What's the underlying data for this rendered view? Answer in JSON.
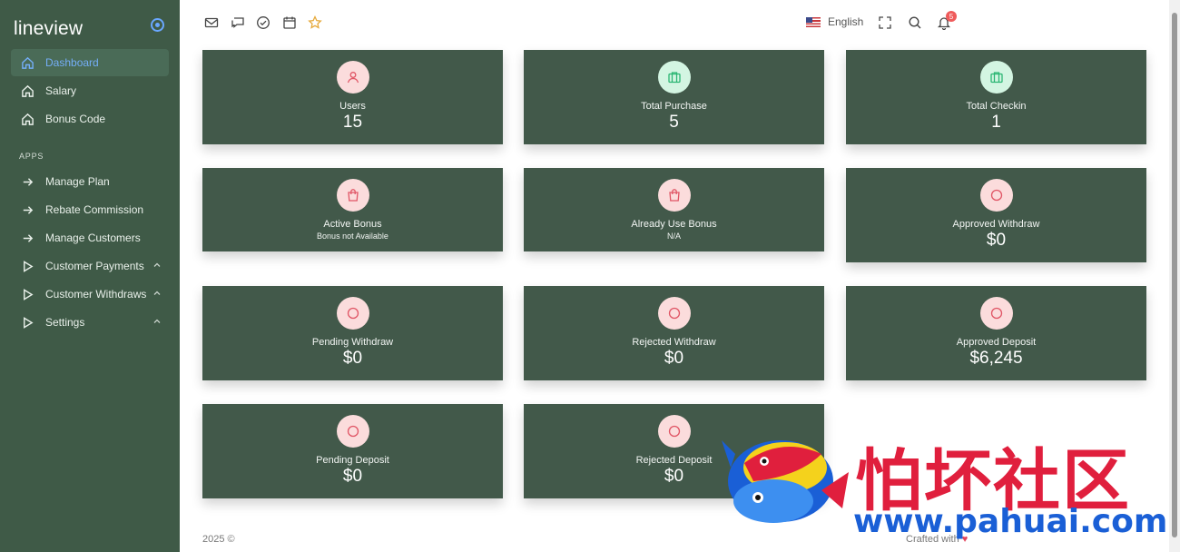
{
  "sidebar": {
    "brand": "lineview",
    "items": [
      {
        "label": "Dashboard"
      },
      {
        "label": "Salary"
      },
      {
        "label": "Bonus Code"
      }
    ],
    "section_label": "APPS",
    "apps": [
      {
        "label": "Manage Plan"
      },
      {
        "label": "Rebate Commission"
      },
      {
        "label": "Manage Customers"
      },
      {
        "label": "Customer Payments"
      },
      {
        "label": "Customer Withdraws"
      },
      {
        "label": "Settings"
      }
    ]
  },
  "topbar": {
    "language": "English",
    "notification_count": "5"
  },
  "cards": [
    {
      "label": "Users",
      "value": "15"
    },
    {
      "label": "Total Purchase",
      "value": "5"
    },
    {
      "label": "Total Checkin",
      "value": "1"
    },
    {
      "label": "Active Bonus",
      "sub": "Bonus not Available"
    },
    {
      "label": "Already Use Bonus",
      "sub": "N/A"
    },
    {
      "label": "Approved Withdraw",
      "value": "$0"
    },
    {
      "label": "Pending Withdraw",
      "value": "$0"
    },
    {
      "label": "Rejected Withdraw",
      "value": "$0"
    },
    {
      "label": "Approved Deposit",
      "value": "$6,245"
    },
    {
      "label": "Pending Deposit",
      "value": "$0"
    },
    {
      "label": "Rejected Deposit",
      "value": "$0"
    }
  ],
  "footer": {
    "copyright": "2025 ©",
    "crafted": "Crafted with"
  },
  "watermark": {
    "text": "怕坏社区",
    "url": "www.pahuai.com"
  },
  "colors": {
    "sidebar_bg": "#3f5a47",
    "card_bg": "#42594a",
    "active_link": "#74aef7",
    "badge": "#ef5b5b"
  }
}
